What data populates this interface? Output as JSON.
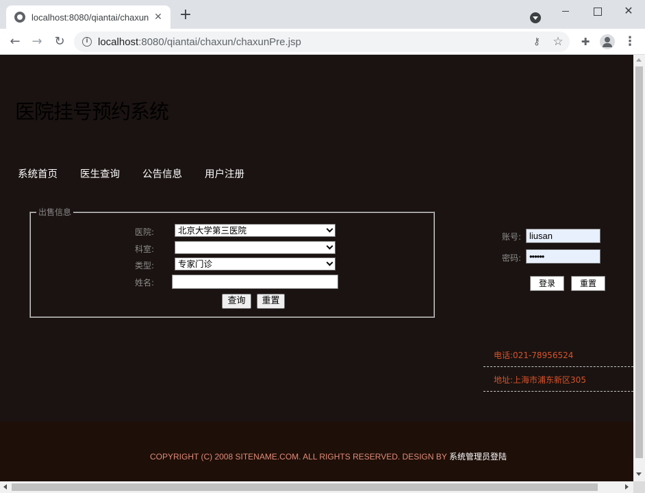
{
  "browser": {
    "tab_title": "localhost:8080/qiantai/chaxun/",
    "url_host": "localhost",
    "url_rest": ":8080/qiantai/chaxun/chaxunPre.jsp",
    "tab_close": "✕",
    "new_tab": "+",
    "win_close": "✕"
  },
  "site": {
    "title": "医院挂号预约系统"
  },
  "nav": {
    "items": [
      "系统首页",
      "医生查询",
      "公告信息",
      "用户注册"
    ]
  },
  "search_form": {
    "legend": "出售信息",
    "hospital_label": "医院:",
    "hospital_value": "北京大学第三医院",
    "department_label": "科室:",
    "department_value": "",
    "type_label": "类型:",
    "type_value": "专家门诊",
    "name_label": "姓名:",
    "name_value": "",
    "query_button": "查询",
    "reset_button": "重置"
  },
  "login": {
    "account_label": "账号:",
    "account_value": "liusan",
    "password_label": "密码:",
    "password_value": "••••••",
    "login_button": "登录",
    "reset_button": "重置"
  },
  "contact": {
    "phone": "电话:021-78956524",
    "address": "地址:上海市浦东新区305"
  },
  "footer": {
    "copyright": "COPYRIGHT (C) 2008 SITENAME.COM. ALL RIGHTS RESERVED. DESIGN BY ",
    "admin_link": "系统管理员登陆"
  }
}
